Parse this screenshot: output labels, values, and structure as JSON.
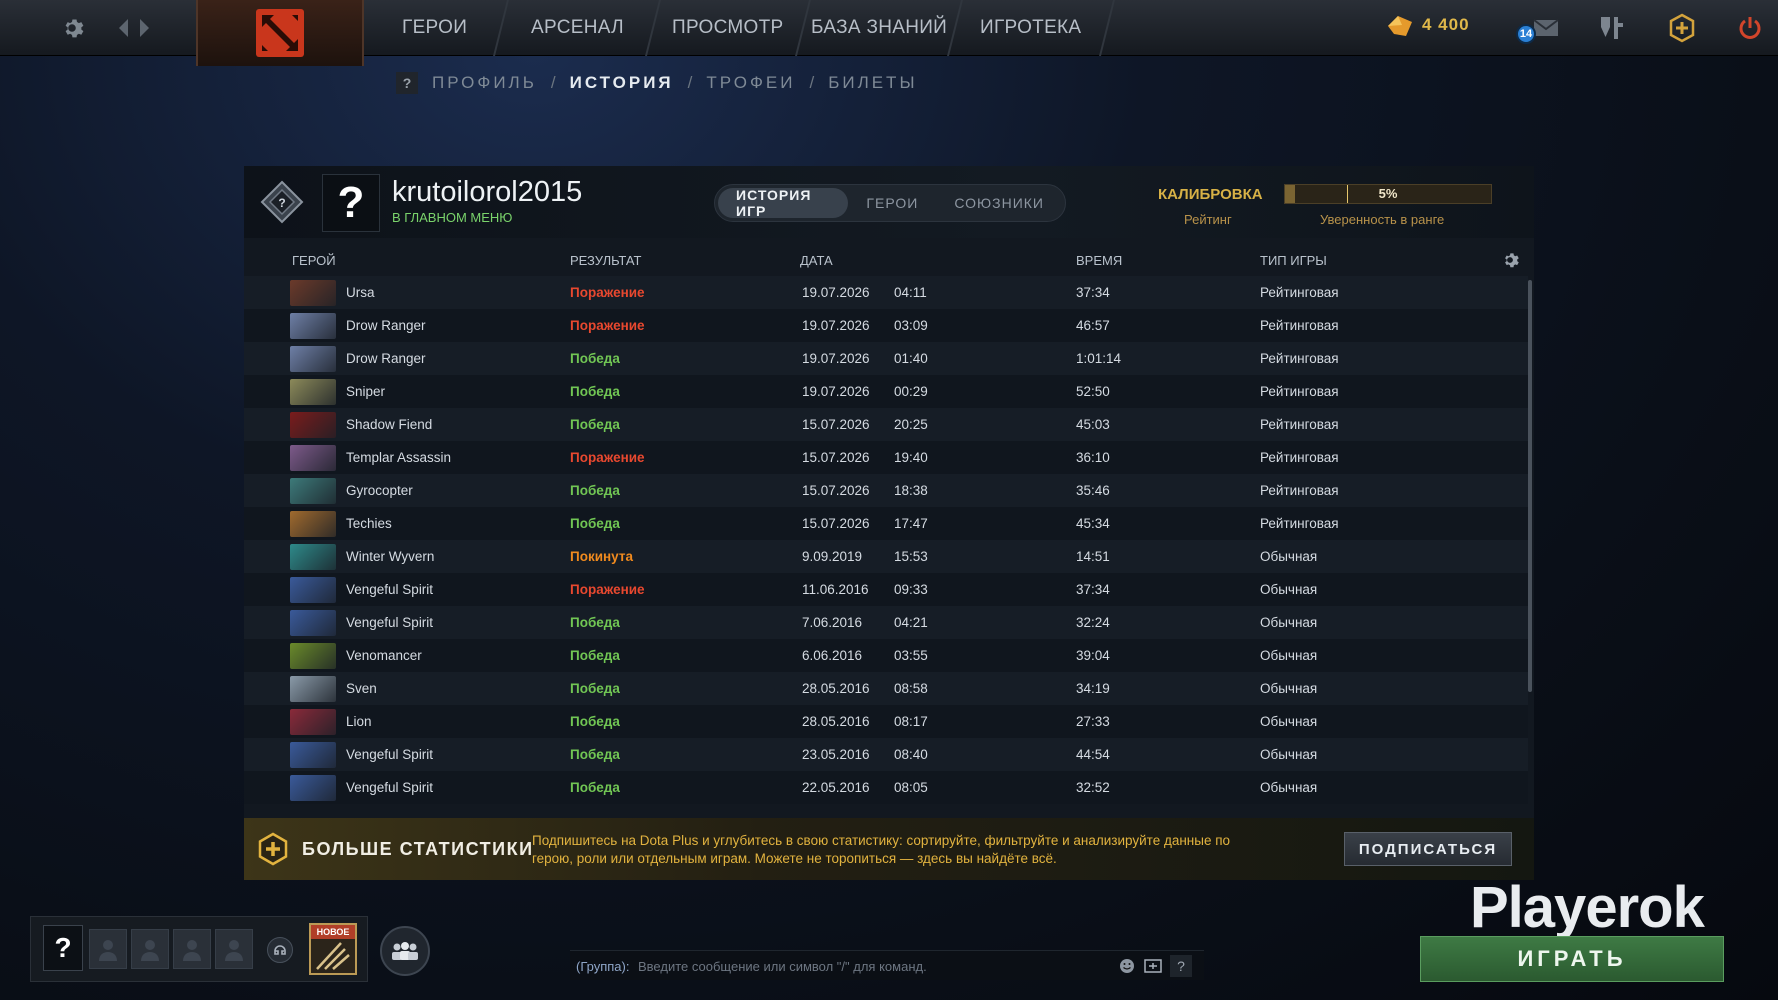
{
  "topnav": {
    "items": [
      "ГЕРОИ",
      "АРСЕНАЛ",
      "ПРОСМОТР",
      "БАЗА ЗНАНИЙ",
      "ИГРОТЕКА"
    ],
    "currency_value": "4 400",
    "notification_count": "14"
  },
  "subnav": {
    "help": "?",
    "items": [
      "ПРОФИЛЬ",
      "ИСТОРИЯ",
      "ТРОФЕИ",
      "БИЛЕТЫ"
    ],
    "active": "ИСТОРИЯ",
    "separator": "/"
  },
  "profile": {
    "avatar_glyph": "?",
    "username": "krutoilorol2015",
    "status": "В ГЛАВНОМ МЕНЮ",
    "tabs": [
      "ИСТОРИЯ ИГР",
      "ГЕРОИ",
      "СОЮЗНИКИ"
    ],
    "active_tab": "ИСТОРИЯ ИГР",
    "calibration_title": "КАЛИБРОВКА",
    "rating_label": "Рейтинг",
    "confidence_label": "Уверенность в ранге",
    "confidence_value": "5%",
    "confidence_fraction": 0.05
  },
  "table": {
    "headers": {
      "hero": "ГЕРОЙ",
      "result": "РЕЗУЛЬТАТ",
      "date": "ДАТА",
      "time": "ВРЕМЯ",
      "mode": "ТИП ИГРЫ"
    },
    "rows": [
      {
        "hero": "Ursa",
        "result": "Поражение",
        "date": "19.07.2026",
        "clock": "04:11",
        "duration": "37:34",
        "mode": "Рейтинговая",
        "portrait_color": "#6b3a2a"
      },
      {
        "hero": "Drow Ranger",
        "result": "Поражение",
        "date": "19.07.2026",
        "clock": "03:09",
        "duration": "46:57",
        "mode": "Рейтинговая",
        "portrait_color": "#6e7fa6"
      },
      {
        "hero": "Drow Ranger",
        "result": "Победа",
        "date": "19.07.2026",
        "clock": "01:40",
        "duration": "1:01:14",
        "mode": "Рейтинговая",
        "portrait_color": "#6e7fa6"
      },
      {
        "hero": "Sniper",
        "result": "Победа",
        "date": "19.07.2026",
        "clock": "00:29",
        "duration": "52:50",
        "mode": "Рейтинговая",
        "portrait_color": "#8c8a5a"
      },
      {
        "hero": "Shadow Fiend",
        "result": "Победа",
        "date": "15.07.2026",
        "clock": "20:25",
        "duration": "45:03",
        "mode": "Рейтинговая",
        "portrait_color": "#7a1c1c"
      },
      {
        "hero": "Templar Assassin",
        "result": "Поражение",
        "date": "15.07.2026",
        "clock": "19:40",
        "duration": "36:10",
        "mode": "Рейтинговая",
        "portrait_color": "#7d5a8a"
      },
      {
        "hero": "Gyrocopter",
        "result": "Победа",
        "date": "15.07.2026",
        "clock": "18:38",
        "duration": "35:46",
        "mode": "Рейтинговая",
        "portrait_color": "#3d7a7a"
      },
      {
        "hero": "Techies",
        "result": "Победа",
        "date": "15.07.2026",
        "clock": "17:47",
        "duration": "45:34",
        "mode": "Рейтинговая",
        "portrait_color": "#a06a2e"
      },
      {
        "hero": "Winter Wyvern",
        "result": "Покинута",
        "date": "9.09.2019",
        "clock": "15:53",
        "duration": "14:51",
        "mode": "Обычная",
        "portrait_color": "#2e8a8a"
      },
      {
        "hero": "Vengeful Spirit",
        "result": "Поражение",
        "date": "11.06.2016",
        "clock": "09:33",
        "duration": "37:34",
        "mode": "Обычная",
        "portrait_color": "#3a5a9a"
      },
      {
        "hero": "Vengeful Spirit",
        "result": "Победа",
        "date": "7.06.2016",
        "clock": "04:21",
        "duration": "32:24",
        "mode": "Обычная",
        "portrait_color": "#3a5a9a"
      },
      {
        "hero": "Venomancer",
        "result": "Победа",
        "date": "6.06.2016",
        "clock": "03:55",
        "duration": "39:04",
        "mode": "Обычная",
        "portrait_color": "#6a8a2a"
      },
      {
        "hero": "Sven",
        "result": "Победа",
        "date": "28.05.2016",
        "clock": "08:58",
        "duration": "34:19",
        "mode": "Обычная",
        "portrait_color": "#8a9aa8"
      },
      {
        "hero": "Lion",
        "result": "Победа",
        "date": "28.05.2016",
        "clock": "08:17",
        "duration": "27:33",
        "mode": "Обычная",
        "portrait_color": "#8a2a3a"
      },
      {
        "hero": "Vengeful Spirit",
        "result": "Победа",
        "date": "23.05.2016",
        "clock": "08:40",
        "duration": "44:54",
        "mode": "Обычная",
        "portrait_color": "#3a5a9a"
      },
      {
        "hero": "Vengeful Spirit",
        "result": "Победа",
        "date": "22.05.2016",
        "clock": "08:05",
        "duration": "32:52",
        "mode": "Обычная",
        "portrait_color": "#3a5a9a"
      }
    ]
  },
  "dota_plus": {
    "title": "БОЛЬШЕ СТАТИСТИКИ",
    "text": "Подпишитесь на Dota Plus и углубитесь в свою статистику: сортируйте, фильтруйте и анализируйте данные по герою, роли или отдельным играм. Можете не торопиться — здесь вы найдёте всё.",
    "button": "ПОДПИСАТЬСЯ"
  },
  "bottom": {
    "party_help": "?",
    "new_label": "НОВОЕ",
    "chat_channel": "(Группа):",
    "chat_placeholder": "Введите сообщение или символ \"/\" для команд.",
    "chat_help": "?",
    "watermark": "Playerok",
    "play_button": "ИГРАТЬ"
  },
  "colors": {
    "win": "#71c654",
    "loss": "#e8482f",
    "abandon": "#f08a1e",
    "gold": "#d7b146"
  }
}
